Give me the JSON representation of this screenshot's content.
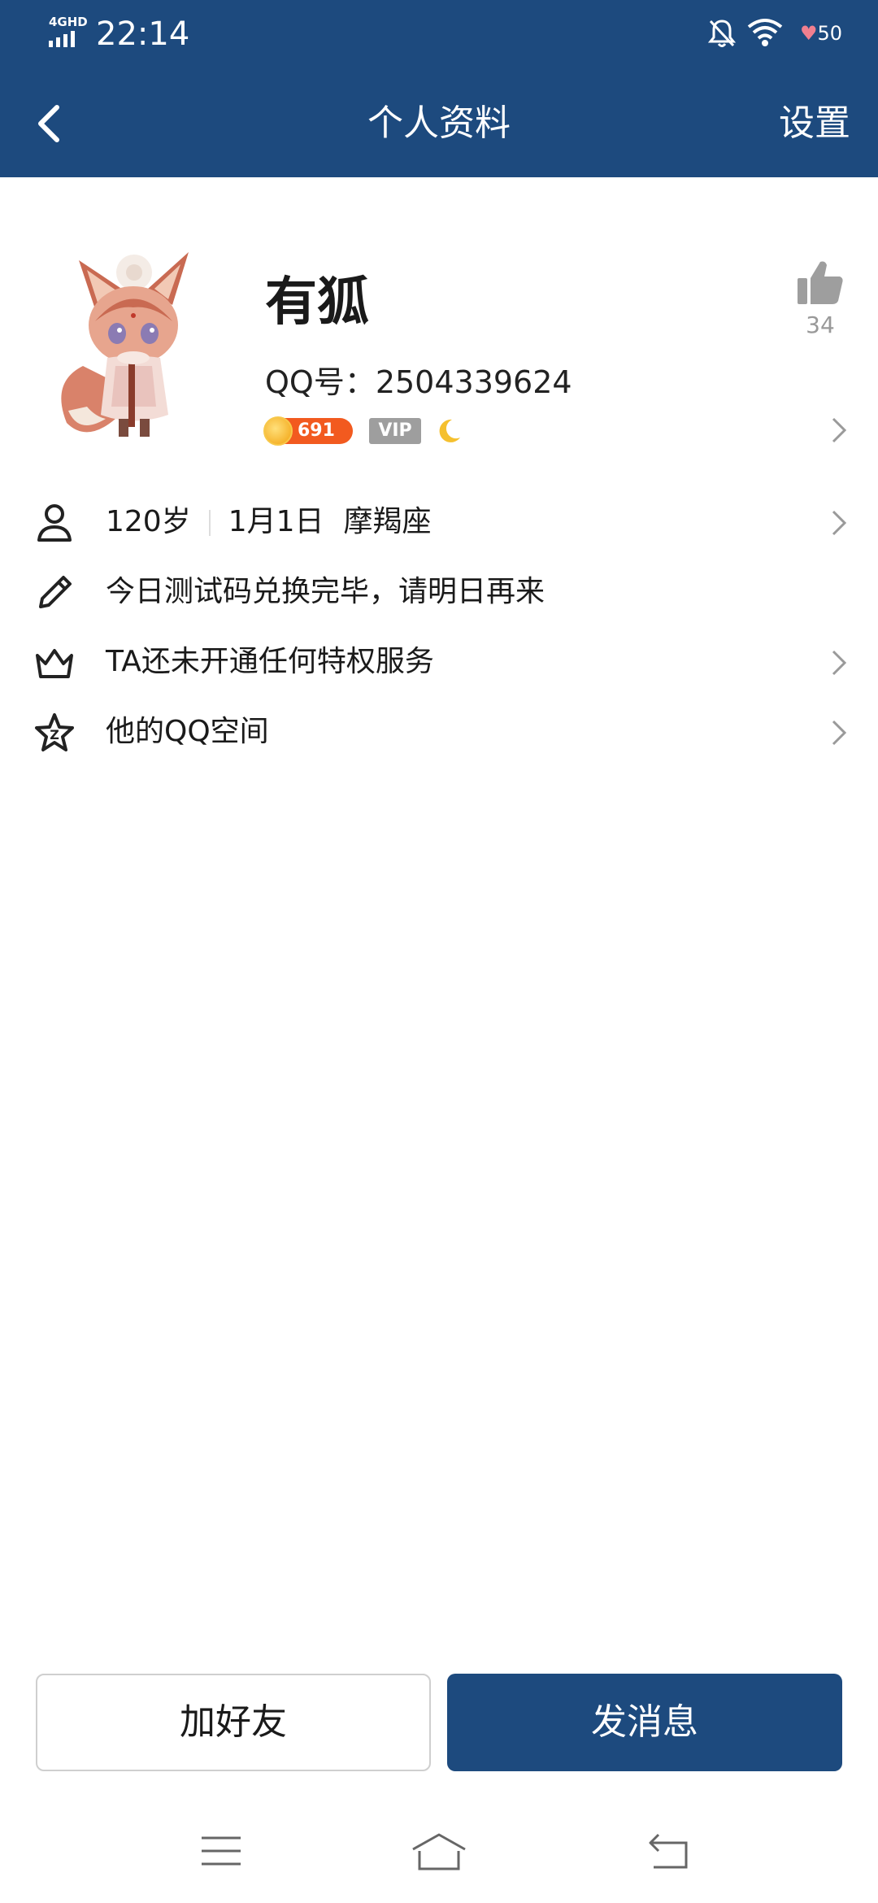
{
  "status_bar": {
    "network": "4GHD",
    "time": "22:14",
    "battery": "50",
    "icons": [
      "signal-icon",
      "bell-muted-icon",
      "wifi-icon",
      "heart-battery-icon"
    ]
  },
  "header": {
    "title": "个人资料",
    "settings_label": "设置"
  },
  "profile": {
    "name": "有狐",
    "qq_number": "QQ号：2504339624",
    "coin_count": "691",
    "vip_label": "VIP",
    "like_count": "34"
  },
  "info_rows": [
    {
      "icon": "person-icon",
      "age": "120岁",
      "birthday": "1月1日",
      "zodiac": "摩羯座"
    },
    {
      "icon": "pencil-icon",
      "text": "今日测试码兑换完毕，请明日再来"
    },
    {
      "icon": "crown-icon",
      "text": "TA还未开通任何特权服务"
    },
    {
      "icon": "star-icon",
      "text": "他的QQ空间"
    }
  ],
  "buttons": {
    "add_friend": "加好友",
    "send_message": "发消息"
  },
  "colors": {
    "brand": "#1d4a7e",
    "coin_badge": "#f25a1f",
    "vip_badge": "#9e9e9e"
  }
}
